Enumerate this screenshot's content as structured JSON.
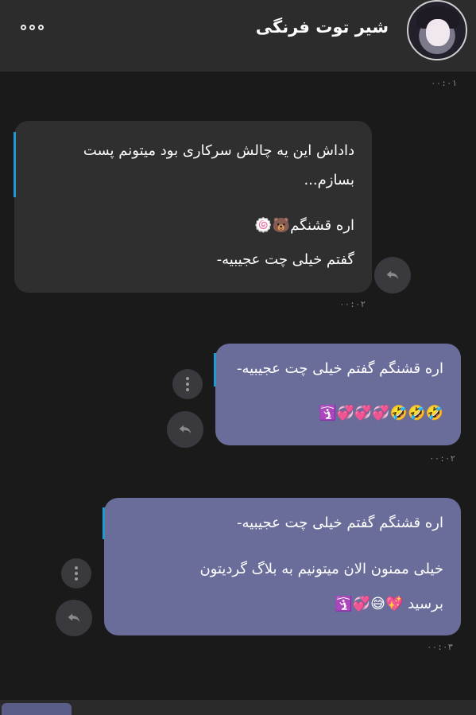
{
  "header": {
    "title": "شیر توت فرنگی",
    "menu_icon": "more-horizontal-icon",
    "avatar_icon": "profile-avatar"
  },
  "messages": [
    {
      "time_above": "۰۰:۰۱",
      "lines": [
        "داداش این یه چالش سرکاری بود میتونم پست",
        "بسازم...",
        "اره قشنگم🐻🍥",
        "گفتم خیلی چت عجیبیه-"
      ],
      "time": "۰۰:۰۲"
    },
    {
      "lines": [
        "اره قشنگم گفتم خیلی چت عجیبیه-",
        "🤣🤣🤣💞💞💞🛐"
      ],
      "time": "۰۰:۰۲"
    },
    {
      "lines": [
        "اره قشنگم گفتم خیلی چت عجیبیه-",
        "خیلی ممنون الان میتونیم به بلاگ گردیتون",
        "برسید 💖😅💞🛐"
      ],
      "time": "۰۰:۰۳"
    }
  ],
  "colors": {
    "background": "#1a1a1a",
    "header": "#2c2c2c",
    "bubble_dark": "#2f2f2f",
    "bubble_purple": "#6a6d99",
    "accent": "#1e9bd7"
  }
}
